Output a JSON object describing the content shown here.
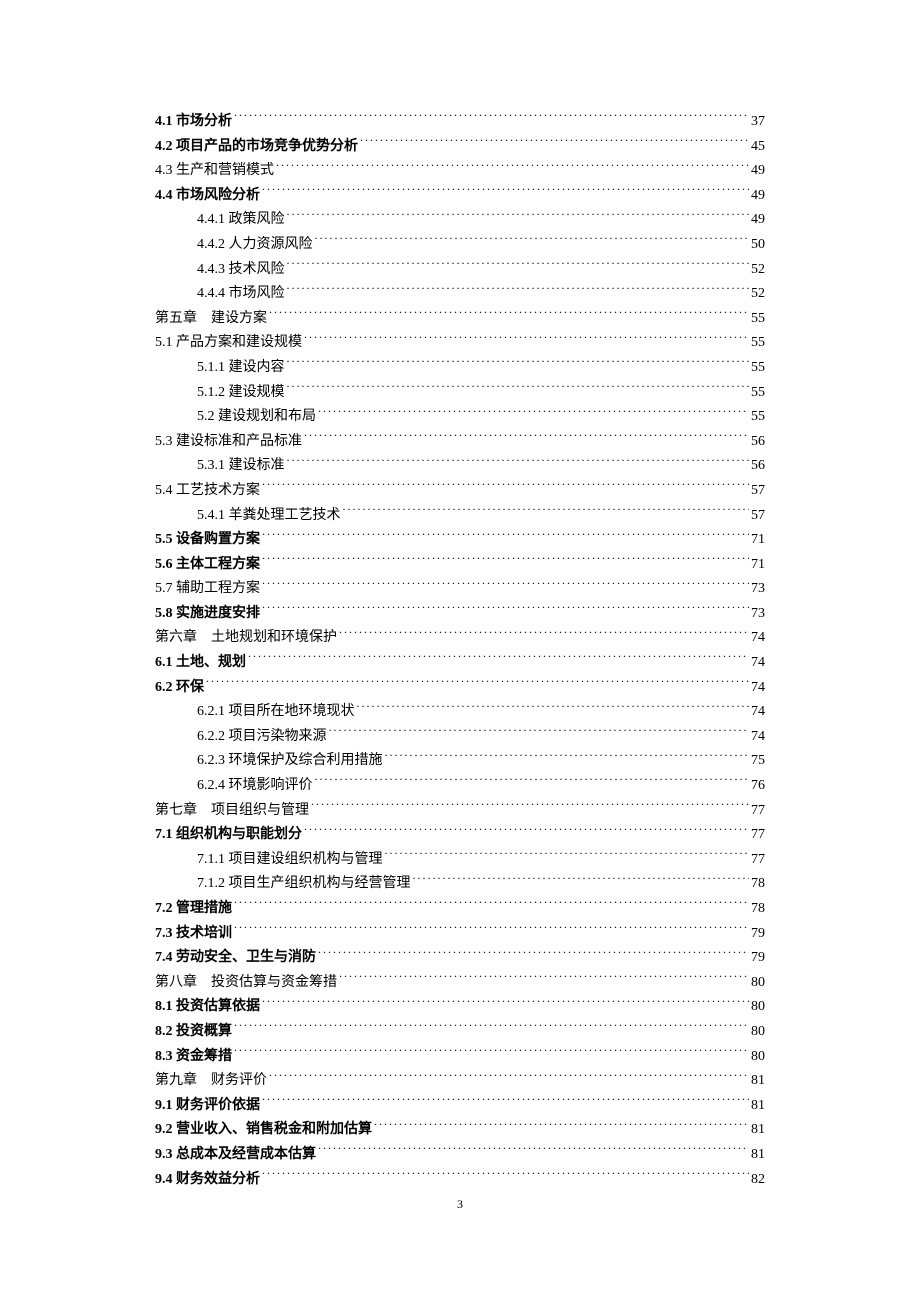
{
  "toc": [
    {
      "level": 2,
      "bold": true,
      "label": "4.1 市场分析",
      "page": "37"
    },
    {
      "level": 2,
      "bold": true,
      "label": "4.2 项目产品的市场竞争优势分析",
      "page": "45"
    },
    {
      "level": 2,
      "bold": false,
      "label": "4.3 生产和营销模式",
      "page": "49"
    },
    {
      "level": 2,
      "bold": true,
      "label": "4.4 市场风险分析",
      "page": "49"
    },
    {
      "level": 3,
      "bold": false,
      "label": "4.4.1 政策风险",
      "page": "49"
    },
    {
      "level": 3,
      "bold": false,
      "label": "4.4.2 人力资源风险",
      "page": "50"
    },
    {
      "level": 3,
      "bold": false,
      "label": "4.4.3 技术风险",
      "page": "52"
    },
    {
      "level": 3,
      "bold": false,
      "label": "4.4.4 市场风险",
      "page": "52"
    },
    {
      "level": 1,
      "bold": false,
      "chapter": "第五章",
      "title": "建设方案",
      "page": "55"
    },
    {
      "level": 2,
      "bold": false,
      "label": "5.1 产品方案和建设规模",
      "page": "55"
    },
    {
      "level": 3,
      "bold": false,
      "label": "5.1.1 建设内容",
      "page": "55"
    },
    {
      "level": 3,
      "bold": false,
      "label": "5.1.2 建设规模",
      "page": "55"
    },
    {
      "level": 3,
      "bold": false,
      "label": "5.2 建设规划和布局",
      "page": "55"
    },
    {
      "level": 2,
      "bold": false,
      "label": "5.3 建设标准和产品标准",
      "page": "56"
    },
    {
      "level": 3,
      "bold": false,
      "label": "5.3.1 建设标准",
      "page": "56"
    },
    {
      "level": 2,
      "bold": false,
      "label": "5.4 工艺技术方案",
      "page": "57"
    },
    {
      "level": 3,
      "bold": false,
      "label": "5.4.1 羊粪处理工艺技术",
      "page": "57"
    },
    {
      "level": 2,
      "bold": true,
      "label": "5.5 设备购置方案",
      "page": "71"
    },
    {
      "level": 2,
      "bold": true,
      "label": "5.6 主体工程方案",
      "page": "71"
    },
    {
      "level": 2,
      "bold": false,
      "label": "5.7 辅助工程方案",
      "page": "73"
    },
    {
      "level": 2,
      "bold": true,
      "label": "5.8 实施进度安排",
      "page": "73"
    },
    {
      "level": 1,
      "bold": false,
      "chapter": "第六章",
      "title": "土地规划和环境保护",
      "page": "74"
    },
    {
      "level": 2,
      "bold": true,
      "label": "6.1 土地、规划",
      "page": "74"
    },
    {
      "level": 2,
      "bold": true,
      "label": "6.2 环保",
      "page": "74"
    },
    {
      "level": 3,
      "bold": false,
      "label": "6.2.1 项目所在地环境现状",
      "page": "74"
    },
    {
      "level": 3,
      "bold": false,
      "label": "6.2.2 项目污染物来源",
      "page": "74"
    },
    {
      "level": 3,
      "bold": false,
      "label": "6.2.3 环境保护及综合利用措施",
      "page": "75"
    },
    {
      "level": 3,
      "bold": false,
      "label": "6.2.4 环境影响评价",
      "page": "76"
    },
    {
      "level": 1,
      "bold": false,
      "chapter": "第七章",
      "title": "项目组织与管理",
      "page": "77"
    },
    {
      "level": 2,
      "bold": true,
      "label": "7.1  组织机构与职能划分",
      "page": "77"
    },
    {
      "level": 3,
      "bold": false,
      "label": "7.1.1  项目建设组织机构与管理",
      "page": "77"
    },
    {
      "level": 3,
      "bold": false,
      "label": "7.1.2  项目生产组织机构与经营管理",
      "page": "78"
    },
    {
      "level": 2,
      "bold": true,
      "label": "7.2  管理措施",
      "page": "78"
    },
    {
      "level": 2,
      "bold": true,
      "label": "7.3  技术培训",
      "page": "79"
    },
    {
      "level": 2,
      "bold": true,
      "label": "7.4  劳动安全、卫生与消防",
      "page": "79"
    },
    {
      "level": 1,
      "bold": false,
      "chapter": "第八章",
      "title": "投资估算与资金筹措",
      "page": "80"
    },
    {
      "level": 2,
      "bold": true,
      "label": "8.1  投资估算依据",
      "page": "80"
    },
    {
      "level": 2,
      "bold": true,
      "label": "8.2  投资概算",
      "page": "80"
    },
    {
      "level": 2,
      "bold": true,
      "label": "8.3  资金筹措",
      "page": "80"
    },
    {
      "level": 1,
      "bold": false,
      "chapter": "第九章",
      "title": "财务评价",
      "page": "81"
    },
    {
      "level": 2,
      "bold": true,
      "label": "9.1  财务评价依据",
      "page": "81"
    },
    {
      "level": 2,
      "bold": true,
      "label": "9.2 营业收入、销售税金和附加估算",
      "page": "81"
    },
    {
      "level": 2,
      "bold": true,
      "label": "9.3 总成本及经营成本估算",
      "page": "81"
    },
    {
      "level": 2,
      "bold": true,
      "label": "9.4 财务效益分析",
      "page": "82"
    }
  ],
  "pageNumber": "3"
}
